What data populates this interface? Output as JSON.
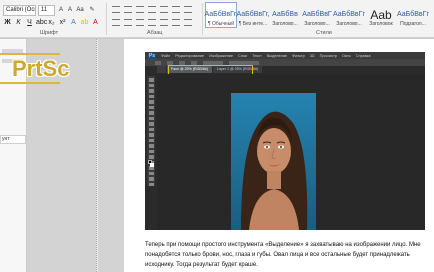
{
  "ribbon": {
    "font_name": "Calibri (Осн",
    "font_size": "11",
    "group_font": "Шрифт",
    "group_paragraph": "Абзац",
    "group_styles": "Стили",
    "styles": [
      {
        "sample": "АаБбВвГг,",
        "label": "¶ Обычный",
        "active": true
      },
      {
        "sample": "АаБбВвГг,",
        "label": "¶ Без инте..."
      },
      {
        "sample": "АаБбВв",
        "label": "Заголово..."
      },
      {
        "sample": "АаБбВвГ",
        "label": "Заголово..."
      },
      {
        "sample": "АаБбВвГг",
        "label": "Заголово..."
      },
      {
        "sample": "Aab",
        "label": "Заголовок"
      },
      {
        "sample": "АаБбВвГг",
        "label": "Подзагол..."
      }
    ]
  },
  "nav": {
    "selected_label": "унт"
  },
  "overlay": {
    "label": "PrtSc",
    "color": "#cfa92e"
  },
  "photoshop": {
    "logo": "Ps",
    "menus": [
      "Файл",
      "Редактирование",
      "Изображение",
      "Слои",
      "Текст",
      "Выделение",
      "Фильтр",
      "3D",
      "Просмотр",
      "Окно",
      "Справка"
    ],
    "tabs": [
      {
        "label": "Face @ 25% (RGB/8#)",
        "active": true
      },
      {
        "label": "Layer 1 @ 25% (RGB/8#)",
        "active": false
      }
    ]
  },
  "document": {
    "caption": "Теперь при помощи простого инструмента «Выделение» я захватываю на изображении лицо. Мне понадобятся только брови, нос, глаза и губы. Овал лица и все остальные будет принадлежать исходнику. Тогда результат будет краше."
  }
}
